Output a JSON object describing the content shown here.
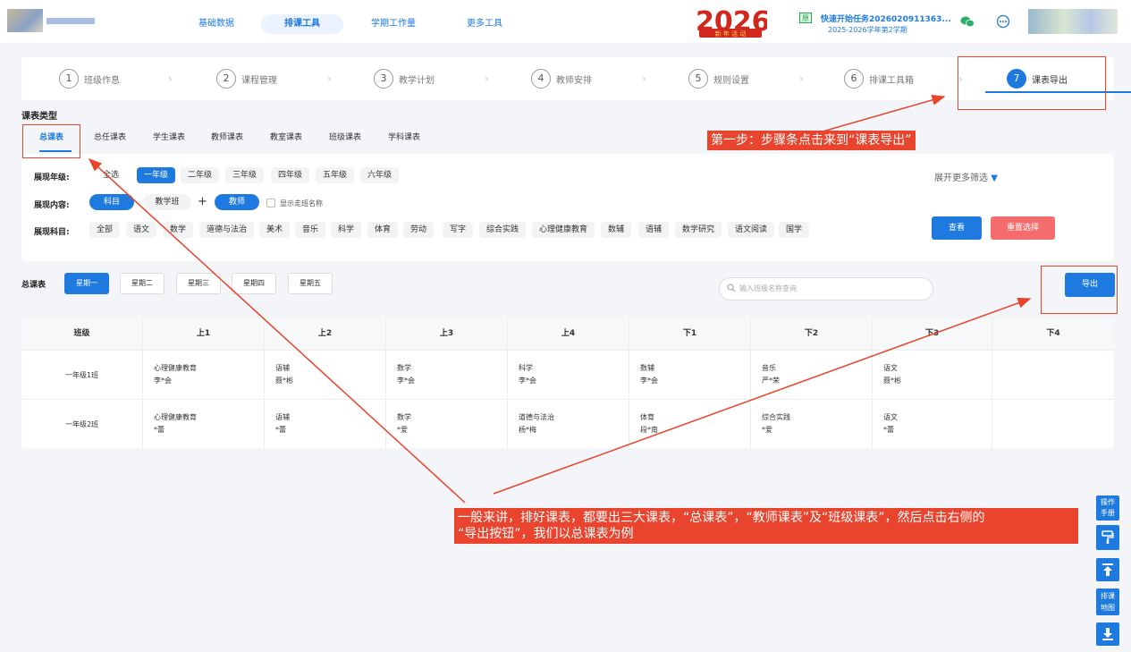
{
  "nav": {
    "items": [
      {
        "label": "基础数据"
      },
      {
        "label": "排课工具"
      },
      {
        "label": "学期工作量"
      },
      {
        "label": "更多工具"
      }
    ],
    "badge_text": "2026",
    "badge_sub": "新 年 活 动"
  },
  "task": {
    "tag": "原",
    "title": "快速开始任务2026020911363...",
    "subtitle": "2025-2026学年第2学期"
  },
  "steps": [
    {
      "num": "1",
      "label": "班级作息"
    },
    {
      "num": "2",
      "label": "课程管理"
    },
    {
      "num": "3",
      "label": "教学计划"
    },
    {
      "num": "4",
      "label": "教师安排"
    },
    {
      "num": "5",
      "label": "规则设置"
    },
    {
      "num": "6",
      "label": "排课工具箱"
    },
    {
      "num": "7",
      "label": "课表导出"
    }
  ],
  "schedule_type_title": "课表类型",
  "schedule_types": [
    "总课表",
    "总任课表",
    "学生课表",
    "教师课表",
    "教室课表",
    "班级课表",
    "学科课表"
  ],
  "filter": {
    "grade_label": "展现年级:",
    "grades": [
      "全选",
      "一年级",
      "二年级",
      "三年级",
      "四年级",
      "五年级",
      "六年级"
    ],
    "content_label": "展现内容:",
    "content_chips": [
      "科目",
      "教学班",
      "教师"
    ],
    "plus": "+",
    "show_name_label": "显示走班名称",
    "subject_label": "展现科目:",
    "subjects": [
      "全部",
      "语文",
      "数学",
      "道德与法治",
      "美术",
      "音乐",
      "科学",
      "体育",
      "劳动",
      "写字",
      "综合实践",
      "心理健康教育",
      "数辅",
      "语辅",
      "数学研究",
      "语文阅读",
      "国学"
    ],
    "more_filter": "展开更多筛选",
    "view_btn": "查看",
    "reset_btn": "重置选择"
  },
  "schedule": {
    "label": "总课表",
    "days": [
      "星期一",
      "星期二",
      "星期三",
      "星期四",
      "星期五"
    ],
    "search_placeholder": "输入班级名称查询",
    "export_btn": "导出"
  },
  "table": {
    "headers": [
      "班级",
      "上1",
      "上2",
      "上3",
      "上4",
      "下1",
      "下2",
      "下3",
      "下4"
    ],
    "rows": [
      {
        "class": "一年级1班",
        "cells": [
          [
            "心理健康教育",
            "李*会"
          ],
          [
            "语辅",
            "聂*彬"
          ],
          [
            "数学",
            "李*会"
          ],
          [
            "科学",
            "李*会"
          ],
          [
            "数辅",
            "李*会"
          ],
          [
            "音乐",
            "严*荣"
          ],
          [
            "语文",
            "聂*彬"
          ],
          [
            "",
            ""
          ]
        ]
      },
      {
        "class": "一年级2班",
        "cells": [
          [
            "心理健康教育",
            "*蕾"
          ],
          [
            "语辅",
            "*蕾"
          ],
          [
            "数学",
            "*爱"
          ],
          [
            "道德与法治",
            "杨*梅"
          ],
          [
            "体育",
            "段*南"
          ],
          [
            "综合实践",
            "*爱"
          ],
          [
            "语文",
            "*蕾"
          ],
          [
            "",
            ""
          ]
        ]
      }
    ]
  },
  "annotations": {
    "step1": "第一步：步骤条点击来到“课表导出”",
    "step2_line1": "一般来讲，排好课表，都要出三大课表，“总课表”，“教师课表”及“班级课表”，然后点击右侧的",
    "step2_line2": "“导出按钮”，我们以总课表为例"
  },
  "side": {
    "manual": [
      "操作",
      "手册"
    ],
    "map": [
      "排课",
      "地图"
    ]
  },
  "colors": {
    "accent": "#1f7ae0",
    "annotation": "#e8442e",
    "reset": "#f56c6c"
  }
}
